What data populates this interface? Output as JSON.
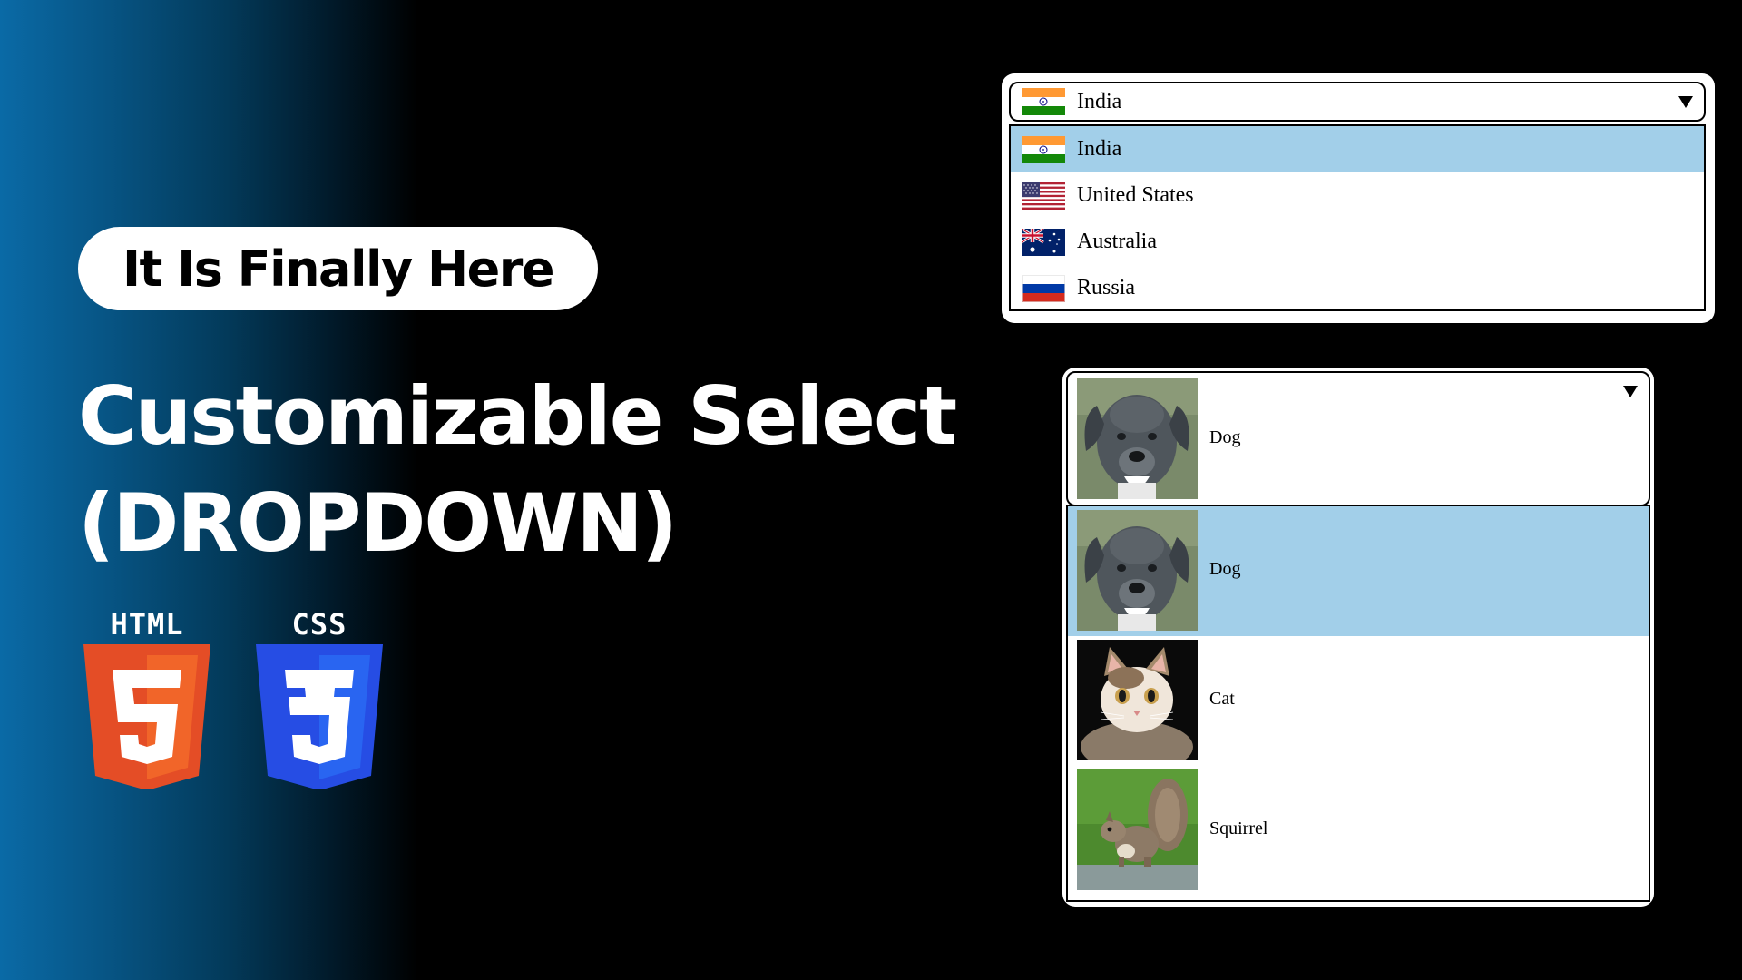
{
  "badge": {
    "text": "It Is Finally Here"
  },
  "headline": {
    "line1": "Customizable Select",
    "line2": "(DROPDOWN)"
  },
  "logos": {
    "html": {
      "word": "HTML",
      "glyph": "5",
      "primary": "#e44d26",
      "secondary": "#f16529"
    },
    "css": {
      "word": "CSS",
      "glyph": "3",
      "primary": "#1572b6",
      "secondary": "#33a9dc"
    }
  },
  "country_select": {
    "selected": "India",
    "arrow_icon": "triangle-down-icon",
    "options": [
      {
        "label": "India",
        "flag": "india-flag-icon",
        "selected": true
      },
      {
        "label": "United States",
        "flag": "usa-flag-icon",
        "selected": false
      },
      {
        "label": "Australia",
        "flag": "australia-flag-icon",
        "selected": false
      },
      {
        "label": "Russia",
        "flag": "russia-flag-icon",
        "selected": false
      }
    ]
  },
  "animal_select": {
    "selected": "Dog",
    "arrow_icon": "triangle-down-icon",
    "options": [
      {
        "label": "Dog",
        "image": "dog-photo",
        "selected": true
      },
      {
        "label": "Cat",
        "image": "cat-photo",
        "selected": false
      },
      {
        "label": "Squirrel",
        "image": "squirrel-photo",
        "selected": false
      }
    ]
  },
  "colors": {
    "highlight": "#a2cfe9",
    "gradient_start": "#0a6aa6",
    "background": "#000000"
  }
}
